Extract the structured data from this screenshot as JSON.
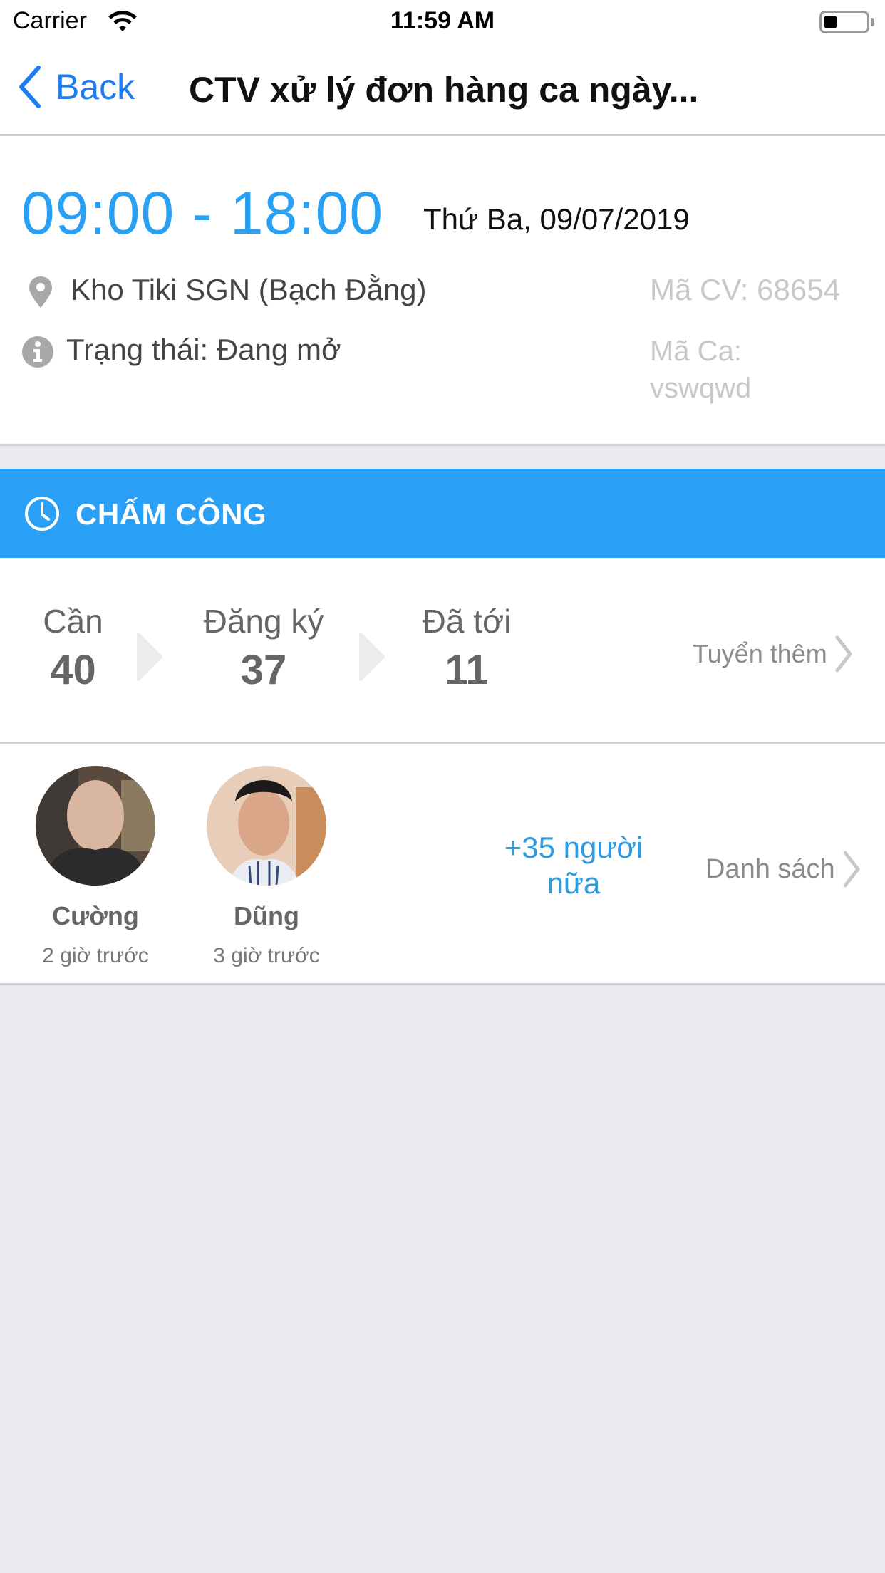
{
  "status_bar": {
    "carrier": "Carrier",
    "time": "11:59 AM",
    "battery_level": 0.3
  },
  "nav": {
    "back_label": "Back",
    "title": "CTV xử lý đơn hàng ca ngày..."
  },
  "shift": {
    "time_range": "09:00 - 18:00",
    "date": "Thứ Ba, 09/07/2019",
    "location": "Kho Tiki SGN (Bạch Đằng)",
    "job_code": "Mã CV: 68654",
    "status": "Trạng thái: Đang mở",
    "shift_code_label": "Mã Ca:",
    "shift_code_value": "vswqwd"
  },
  "attendance": {
    "header": "CHẤM CÔNG",
    "stats": [
      {
        "label": "Cần",
        "value": "40"
      },
      {
        "label": "Đăng ký",
        "value": "37"
      },
      {
        "label": "Đã tới",
        "value": "11"
      }
    ],
    "recruit_more": "Tuyển thêm"
  },
  "people": {
    "items": [
      {
        "name": "Cường",
        "time": "2 giờ trước"
      },
      {
        "name": "Dũng",
        "time": "3 giờ trước"
      }
    ],
    "more_line1": "+35 người",
    "more_line2": "nữa",
    "list_label": "Danh sách"
  },
  "colors": {
    "accent": "#2ba0f7",
    "link_blue": "#1c7cf2",
    "background": "#e9e9ee"
  }
}
